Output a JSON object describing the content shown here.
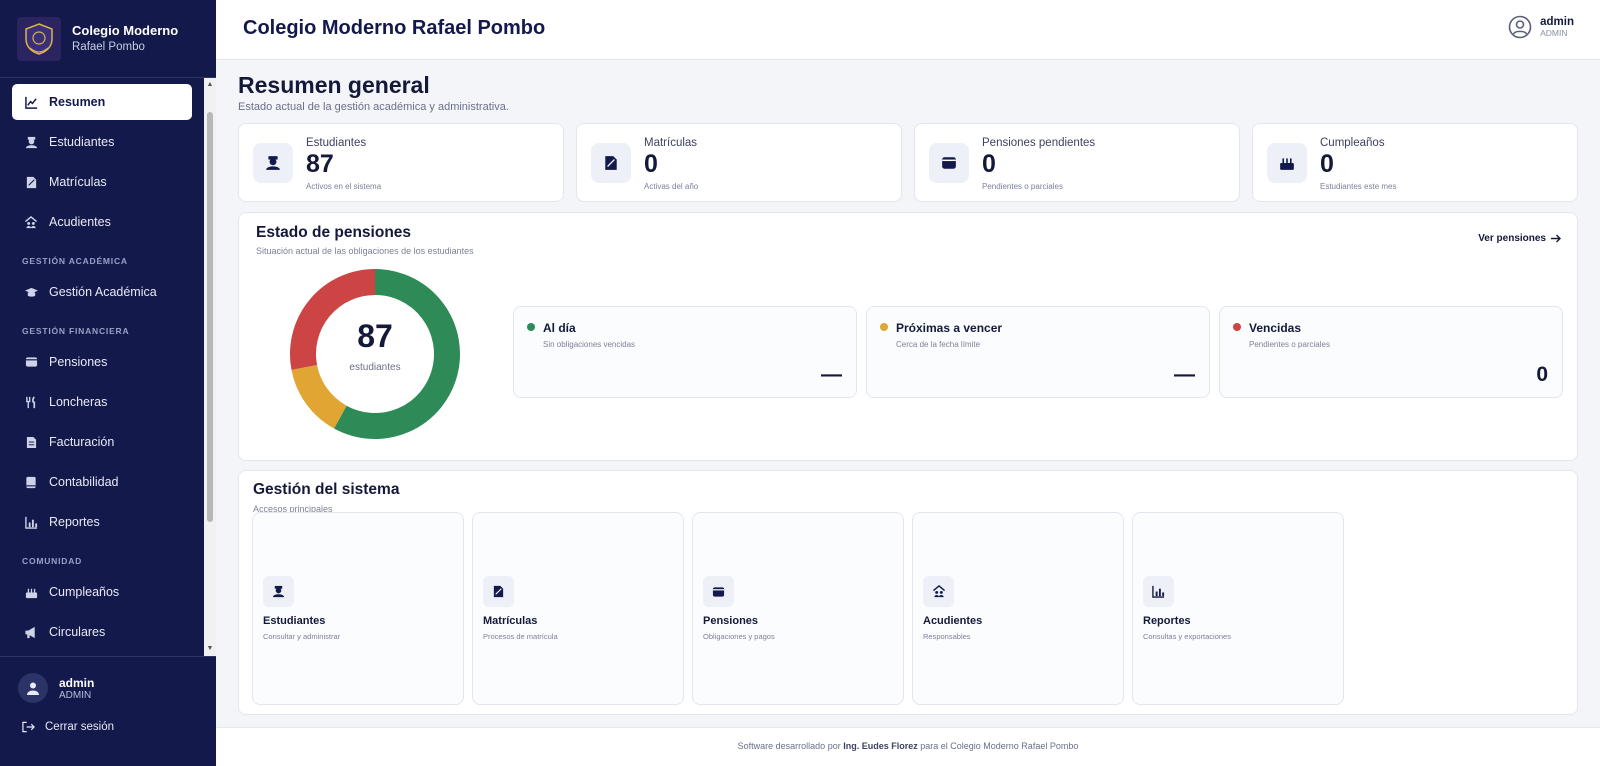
{
  "brand": {
    "name": "Colegio Moderno",
    "sub": "Rafael Pombo"
  },
  "sidebar": {
    "items": [
      {
        "label": "Resumen",
        "icon": "chart-line-icon"
      },
      {
        "label": "Estudiantes",
        "icon": "student-icon"
      },
      {
        "label": "Matrículas",
        "icon": "signature-icon"
      },
      {
        "label": "Acudientes",
        "icon": "people-roof-icon"
      }
    ],
    "section_academica": "GESTIÓN ACADÉMICA",
    "academica": [
      {
        "label": "Gestión Académica",
        "icon": "graduation-cap-icon"
      }
    ],
    "section_financiera": "GESTIÓN FINANCIERA",
    "financiera": [
      {
        "label": "Pensiones",
        "icon": "wallet-icon"
      },
      {
        "label": "Loncheras",
        "icon": "utensils-icon"
      },
      {
        "label": "Facturación",
        "icon": "invoice-icon"
      },
      {
        "label": "Contabilidad",
        "icon": "ledger-icon"
      },
      {
        "label": "Reportes",
        "icon": "bar-chart-icon"
      }
    ],
    "section_comunidad": "COMUNIDAD",
    "comunidad": [
      {
        "label": "Cumpleaños",
        "icon": "cake-icon"
      },
      {
        "label": "Circulares",
        "icon": "megaphone-icon"
      }
    ],
    "user": {
      "name": "admin",
      "role": "ADMIN"
    },
    "logout": "Cerrar sesión"
  },
  "header": {
    "title": "Colegio Moderno Rafael Pombo",
    "user": "admin",
    "role": "ADMIN"
  },
  "main": {
    "title": "Resumen general",
    "subtitle": "Estado actual de la gestión académica y administrativa.",
    "stats": [
      {
        "label": "Estudiantes",
        "value": "87",
        "note": "Activos en el sistema"
      },
      {
        "label": "Matrículas",
        "value": "0",
        "note": "Activas del año"
      },
      {
        "label": "Pensiones pendientes",
        "value": "0",
        "note": "Pendientes o parciales"
      },
      {
        "label": "Cumpleaños",
        "value": "0",
        "note": "Estudiantes este mes"
      }
    ],
    "pensiones": {
      "title": "Estado de pensiones",
      "subtitle": "Situación actual de las obligaciones de los estudiantes",
      "link": "Ver pensiones",
      "total": "87",
      "total_label": "estudiantes",
      "legend": [
        {
          "title": "Al día",
          "sub": "Sin obligaciones vencidas",
          "value": "—",
          "color": "#2e8b57"
        },
        {
          "title": "Próximas a vencer",
          "sub": "Cerca de la fecha límite",
          "value": "—",
          "color": "#e0a532"
        },
        {
          "title": "Vencidas",
          "sub": "Pendientes o parciales",
          "value": "0",
          "color": "#cc4444"
        }
      ]
    },
    "gestion": {
      "title": "Gestión del sistema",
      "subtitle": "Accesos principales",
      "tiles": [
        {
          "title": "Estudiantes",
          "sub": "Consultar y administrar"
        },
        {
          "title": "Matrículas",
          "sub": "Procesos de matrícula"
        },
        {
          "title": "Pensiones",
          "sub": "Obligaciones y pagos"
        },
        {
          "title": "Acudientes",
          "sub": "Responsables"
        },
        {
          "title": "Reportes",
          "sub": "Consultas y exportaciones"
        }
      ]
    }
  },
  "chart_data": {
    "type": "pie",
    "categories": [
      "Al día",
      "Próximas a vencer",
      "Vencidas"
    ],
    "values": [
      58,
      14,
      28
    ],
    "colors": [
      "#2e8b57",
      "#e0a532",
      "#cc4444"
    ]
  },
  "footer": {
    "prefix": "Software desarrollado por",
    "author": "Ing. Eudes Florez",
    "suffix": "para el Colegio Moderno Rafael Pombo"
  }
}
